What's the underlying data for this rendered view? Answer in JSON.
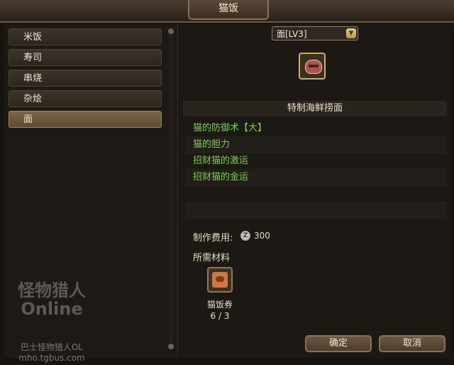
{
  "window": {
    "title": "猫饭"
  },
  "sidebar": {
    "items": [
      {
        "label": "米饭"
      },
      {
        "label": "寿司"
      },
      {
        "label": "串烧"
      },
      {
        "label": "杂烩"
      },
      {
        "label": "面",
        "selected": true
      }
    ]
  },
  "detail": {
    "dropdown_value": "面[LV3]",
    "dish_name": "特制海鲜捞面",
    "effects": [
      "猫的防御术【大】",
      "猫的胆力",
      "招财猫的激运",
      "招财猫的金运"
    ],
    "cost_label": "制作费用:",
    "currency_icon_glyph": "Z",
    "cost_value": "300",
    "materials_title": "所需材料",
    "materials": [
      {
        "name": "猫饭券",
        "count": "6 / 3"
      }
    ]
  },
  "buttons": {
    "confirm": "确定",
    "cancel": "取消"
  },
  "watermark": {
    "logo_text": "怪物猎人 Online",
    "line1": "巴士怪物猎人OL",
    "line2": "mho.tgbus.com"
  },
  "icons": {
    "dish": "noodle-bowl-icon",
    "material": "meal-ticket-icon",
    "currency": "zenny-coin-icon",
    "dropdown": "chevron-down-icon"
  }
}
